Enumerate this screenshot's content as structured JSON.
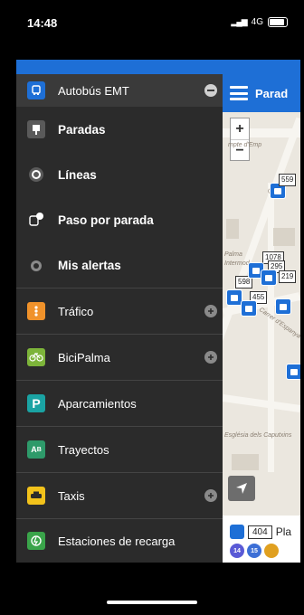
{
  "status": {
    "time": "14:48",
    "network": "4G"
  },
  "map": {
    "header_title": "Parad",
    "labels": [
      "mpte d'Emp",
      "Carrer d",
      "Palma",
      "Intermod",
      "Carrer d'Espanya",
      "Església dels Caputxins"
    ],
    "stop_numbers": [
      "559",
      "1078",
      "295",
      "219",
      "598",
      "455"
    ],
    "zoom_in": "+",
    "zoom_out": "−",
    "bottom_card": {
      "stop_number": "404",
      "stop_text": "Pla",
      "lines": [
        "14",
        "15"
      ]
    }
  },
  "menu": {
    "items": [
      {
        "label": "Autobús EMT",
        "icon": "bus-icon",
        "color": "#1e6fd6",
        "bold": false,
        "expand": true,
        "header": true
      },
      {
        "label": "Paradas",
        "icon": "stop-sign-icon",
        "color": "#4d4d4d",
        "bold": true,
        "expand": false
      },
      {
        "label": "Líneas",
        "icon": "route-circle-icon",
        "color": "#4d4d4d",
        "bold": true,
        "expand": false
      },
      {
        "label": "Paso por parada",
        "icon": "bus-time-icon",
        "color": "#4d4d4d",
        "bold": true,
        "expand": false
      },
      {
        "label": "Mis alertas",
        "icon": "alarm-icon",
        "color": "#4d4d4d",
        "bold": true,
        "expand": false
      },
      {
        "label": "Tráfico",
        "icon": "traffic-light-icon",
        "color": "#f0922a",
        "bold": false,
        "expand": true
      },
      {
        "label": "BiciPalma",
        "icon": "bicycle-icon",
        "color": "#7db43a",
        "bold": false,
        "expand": true
      },
      {
        "label": "Aparcamientos",
        "icon": "parking-icon",
        "color": "#1aa3a3",
        "bold": false,
        "expand": false
      },
      {
        "label": "Trayectos",
        "icon": "route-ab-icon",
        "color": "#2e9a6a",
        "bold": false,
        "expand": false
      },
      {
        "label": "Taxis",
        "icon": "taxi-icon",
        "color": "#f2c21b",
        "bold": false,
        "expand": true
      },
      {
        "label": "Estaciones de recarga",
        "icon": "charging-icon",
        "color": "#3aa44a",
        "bold": false,
        "expand": false
      }
    ]
  }
}
